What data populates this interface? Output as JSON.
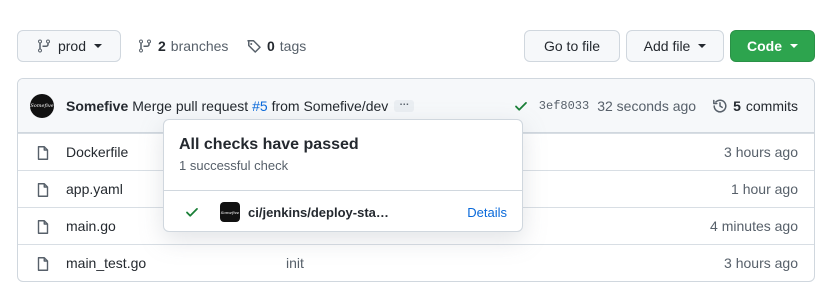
{
  "toolbar": {
    "branch_label": "prod",
    "branches_count": "2",
    "branches_text": "branches",
    "tags_count": "0",
    "tags_text": "tags",
    "goto_file_label": "Go to file",
    "add_file_label": "Add file",
    "code_label": "Code"
  },
  "commit": {
    "avatar_text": "Somefive",
    "author": "Somefive",
    "message_prefix": "Merge pull request",
    "pr_link": "#5",
    "message_suffix": "from Somefive/dev",
    "ellipsis": "…",
    "sha": "3ef8033",
    "time": "32 seconds ago",
    "commits_count": "5",
    "commits_text": "commits",
    "status_color": "#1a7f37"
  },
  "files": [
    {
      "name": "Dockerfile",
      "commit": "",
      "time": "3 hours ago"
    },
    {
      "name": "app.yaml",
      "commit": "",
      "time": "1 hour ago"
    },
    {
      "name": "main.go",
      "commit": "",
      "time": "4 minutes ago"
    },
    {
      "name": "main_test.go",
      "commit": "init",
      "time": "3 hours ago"
    }
  ],
  "popover": {
    "title": "All checks have passed",
    "subtitle": "1 successful check",
    "check_name": "ci/jenkins/deploy-sta…",
    "details_label": "Details",
    "avatar_text": "Somefive"
  },
  "colors": {
    "accent_green": "#2da44e",
    "link_blue": "#0969da"
  }
}
